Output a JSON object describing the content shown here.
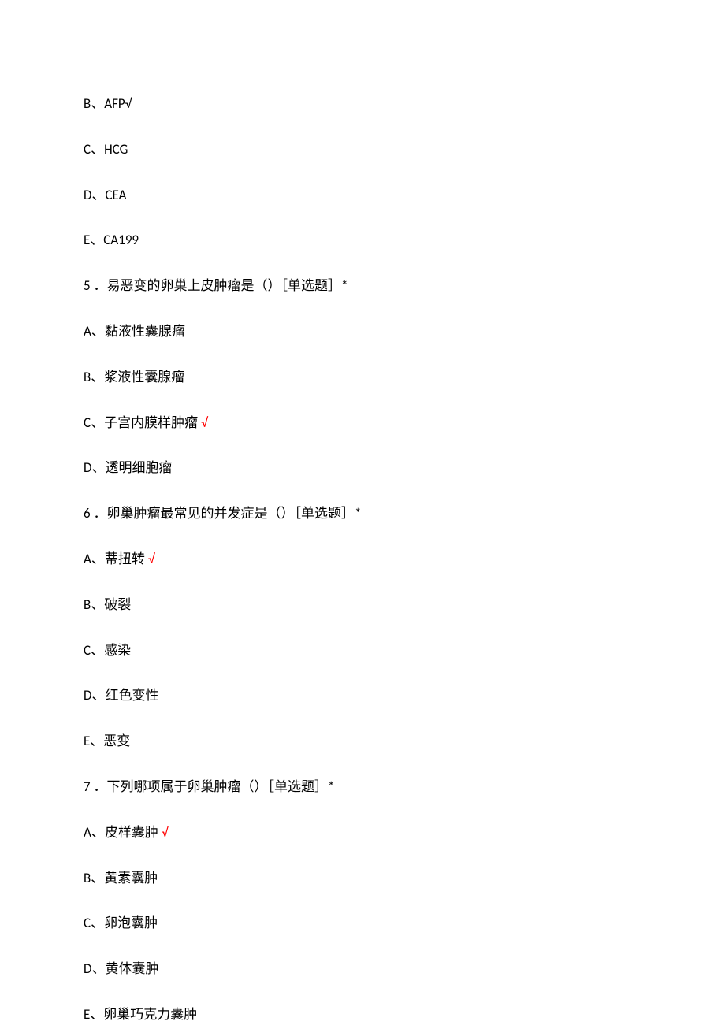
{
  "lines": [
    {
      "text": "B、AFP√",
      "check": false
    },
    {
      "text": "C、HCG",
      "check": false
    },
    {
      "text": "D、CEA",
      "check": false
    },
    {
      "text": "E、CA199",
      "check": false
    },
    {
      "text": "5 ．易恶变的卵巢上皮肿瘤是（）［单选题］*",
      "check": false
    },
    {
      "text": "A、黏液性囊腺瘤",
      "check": false
    },
    {
      "text": "B、浆液性囊腺瘤",
      "check": false
    },
    {
      "text": "C、子宫内膜样肿瘤",
      "check": true
    },
    {
      "text": "D、透明细胞瘤",
      "check": false
    },
    {
      "text": "6 ．卵巢肿瘤最常见的并发症是（）［单选题］*",
      "check": false
    },
    {
      "text": "A、蒂扭转",
      "check": true
    },
    {
      "text": "B、破裂",
      "check": false
    },
    {
      "text": "C、感染",
      "check": false
    },
    {
      "text": "D、红色变性",
      "check": false
    },
    {
      "text": "E、恶变",
      "check": false
    },
    {
      "text": "7 ．下列哪项属于卵巢肿瘤（）［单选题］*",
      "check": false
    },
    {
      "text": "A、皮样囊肿",
      "check": true
    },
    {
      "text": "B、黄素囊肿",
      "check": false
    },
    {
      "text": "C、卵泡囊肿",
      "check": false
    },
    {
      "text": "D、黄体囊肿",
      "check": false
    },
    {
      "text": "E、卵巢巧克力囊肿",
      "check": false
    }
  ],
  "checkSymbol": "√"
}
